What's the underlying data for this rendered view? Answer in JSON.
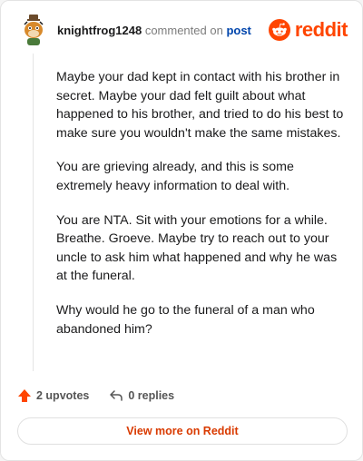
{
  "header": {
    "username": "knightfrog1248",
    "commented_on": "commented on",
    "post_link": "post",
    "logo_text": "reddit"
  },
  "comment": {
    "paragraphs": [
      "Maybe your dad kept in contact with his brother in secret. Maybe your dad felt guilt about what happened to his brother, and tried to do his best to make sure you wouldn't make the same mistakes.",
      "You are grieving already, and this is some extremely heavy information to deal with.",
      "You are NTA. Sit with your emotions for a while. Breathe. Groeve. Maybe try to reach out to your uncle to ask him what happened and why he was at the funeral.",
      "Why would he go to the funeral of a man who abandoned him?"
    ]
  },
  "actions": {
    "upvotes": "2 upvotes",
    "replies": "0 replies"
  },
  "footer": {
    "view_more": "View more on Reddit"
  },
  "colors": {
    "brand": "#ff4500",
    "link": "#0045ac",
    "view_more": "#d93a00"
  },
  "icons": {
    "avatar": "snoo-avatar",
    "logo": "reddit-snoo-icon",
    "upvote": "upvote-arrow-icon",
    "reply": "reply-arrow-icon"
  }
}
